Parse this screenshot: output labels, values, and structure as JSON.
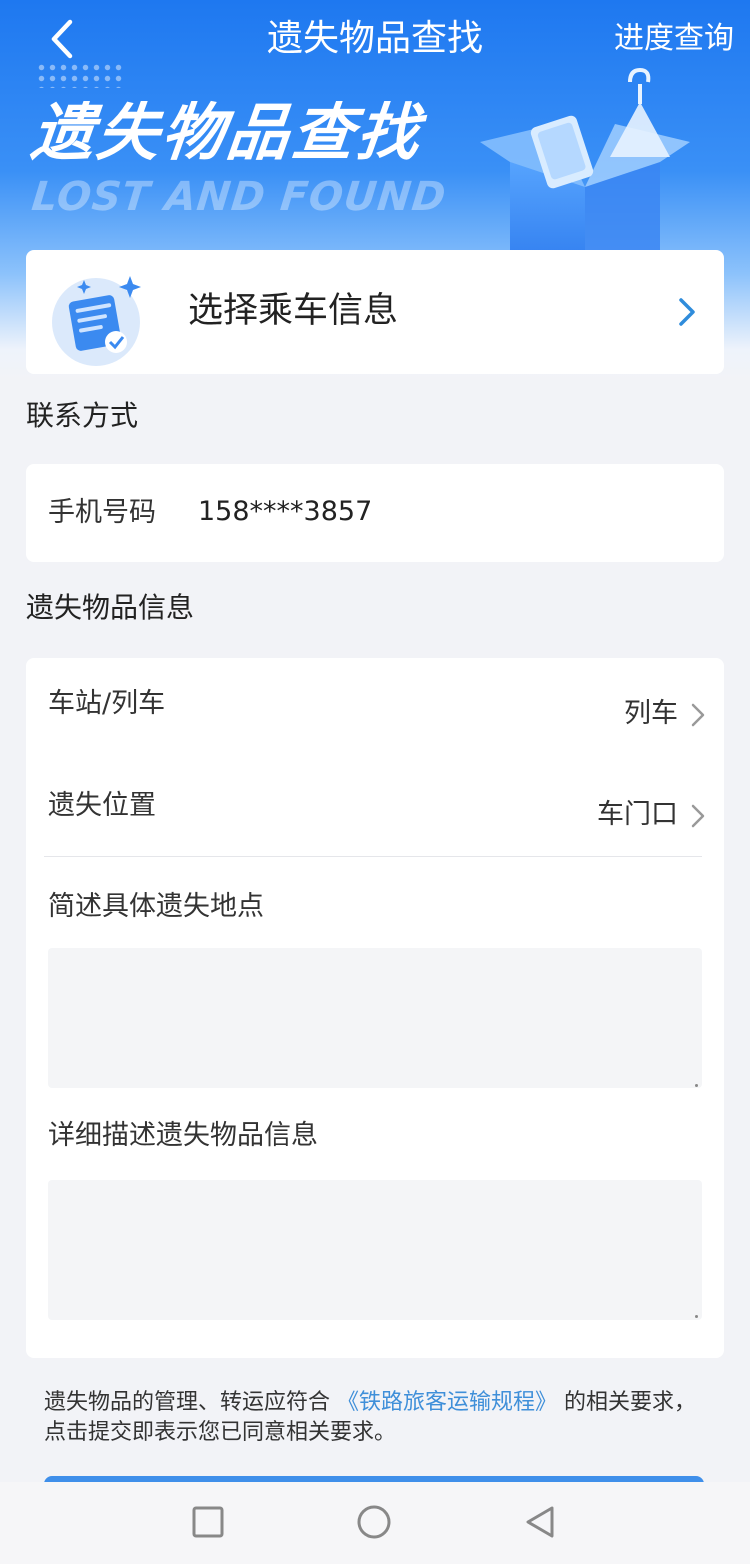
{
  "nav": {
    "title": "遗失物品查找",
    "right_action": "进度查询"
  },
  "hero": {
    "title": "遗失物品查找",
    "subtitle": "LOST AND FOUND"
  },
  "select_trip": {
    "label": "选择乘车信息"
  },
  "contact": {
    "section_title": "联系方式",
    "phone_label": "手机号码",
    "phone_value": "158****3857"
  },
  "item_info": {
    "section_title": "遗失物品信息",
    "station_label": "车站/列车",
    "station_value": "列车",
    "location_label": "遗失位置",
    "location_value": "车门口",
    "place_label": "简述具体遗失地点",
    "place_value": "",
    "detail_label": "详细描述遗失物品信息",
    "detail_value": ""
  },
  "notice": {
    "text_before": "遗失物品的管理、转运应符合",
    "link_text": "《铁路旅客运输规程》",
    "text_after": "的相关要求，点击提交即表示您已同意相关要求。"
  },
  "colors": {
    "primary": "#1e78f0",
    "link": "#3f8fd9",
    "chevron": "#2f8cdb",
    "background": "#f2f3f7"
  },
  "icons": {
    "back": "chevron-left-icon",
    "select_trip": "document-check-icon",
    "chevron": "chevron-right-icon",
    "sys_recent": "square-icon",
    "sys_home": "circle-icon",
    "sys_back": "triangle-back-icon"
  }
}
